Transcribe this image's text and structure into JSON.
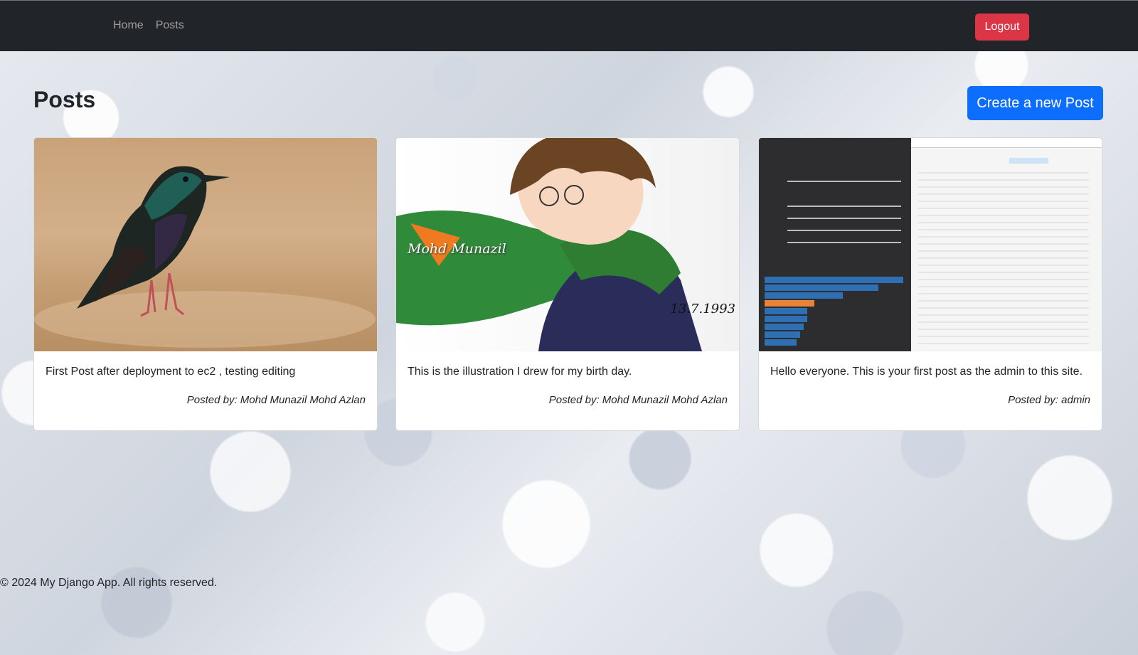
{
  "nav": {
    "links": [
      "Home",
      "Posts"
    ],
    "logout_label": "Logout"
  },
  "page": {
    "title": "Posts",
    "create_label": "Create a new Post"
  },
  "posts": [
    {
      "text": "First Post after deployment to ec2 , testing editing",
      "posted_by_label": "Posted by:",
      "author": "Mohd Munazil Mohd Azlan",
      "image": "bird-photo"
    },
    {
      "text": "This is the illustration I drew for my birth day.",
      "posted_by_label": "Posted by:",
      "author": "Mohd Munazil Mohd Azlan",
      "image": "anime-illustration",
      "image_caption_name": "Mohd Munazil",
      "image_caption_date": "13.7.1993"
    },
    {
      "text": "Hello everyone. This is your first post as the admin to this site.",
      "posted_by_label": "Posted by:",
      "author": "admin",
      "image": "hardware-monitor-screenshot"
    }
  ],
  "footer": {
    "text": "© 2024 My Django App. All rights reserved."
  },
  "colors": {
    "navbar": "#212529",
    "logout": "#dc3545",
    "primary": "#0d6efd"
  }
}
